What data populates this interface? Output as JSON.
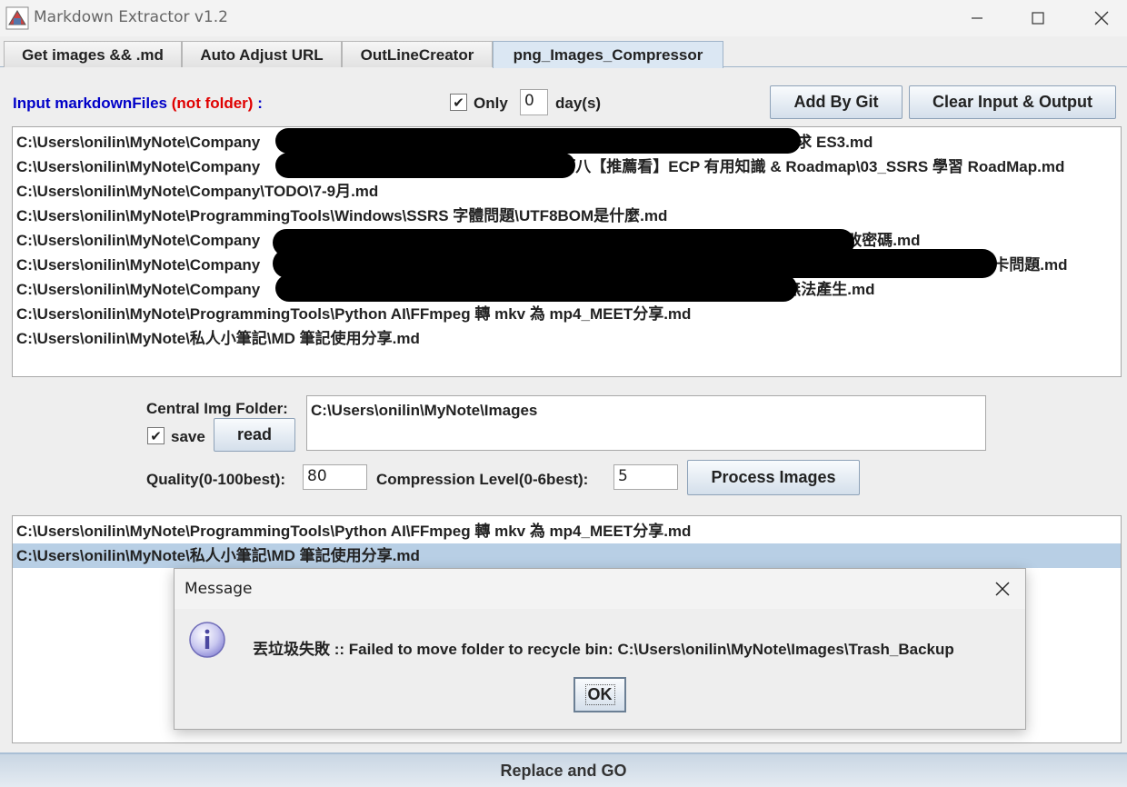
{
  "window": {
    "title": "Markdown Extractor v1.2"
  },
  "tabs": [
    {
      "label": "Get images && .md"
    },
    {
      "label": "Auto Adjust URL"
    },
    {
      "label": "OutLineCreator"
    },
    {
      "label": "png_Images_Compressor",
      "active": true
    }
  ],
  "input_section": {
    "label": "Input markdownFiles",
    "label_note": "(not folder)",
    "label_colon": ":",
    "only_checked": true,
    "only_label": "Only",
    "days_value": "0",
    "days_label": "day(s)",
    "add_by_git": "Add By Git",
    "clear_io": "Clear Input & Output",
    "files": [
      "C:\\Users\\onilin\\MyNote\\Company",
      "C:\\Users\\onilin\\MyNote\\Company",
      "C:\\Users\\onilin\\MyNote\\Company\\TODO\\7-9月.md",
      "C:\\Users\\onilin\\MyNote\\ProgrammingTools\\Windows\\SSRS 字體問題\\UTF8BOM是什麼.md",
      "C:\\Users\\onilin\\MyNote\\Company",
      "C:\\Users\\onilin\\MyNote\\Company",
      "C:\\Users\\onilin\\MyNote\\Company",
      "C:\\Users\\onilin\\MyNote\\ProgrammingTools\\Python AI\\FFmpeg 轉 mkv 為 mp4_MEET分享.md",
      "C:\\Users\\onilin\\MyNote\\私人小筆記\\MD 筆記使用分享.md"
    ],
    "file_suffixes": [
      "求 ES3.md",
      "巧八【推薦看】ECP 有用知識 & Roadmap\\03_SSRS 學習 RoadMap.md",
      "",
      "",
      "麼改密碼.md",
      "打卡問題.md",
      "無法產生.md",
      "",
      ""
    ]
  },
  "settings": {
    "central_img_label": "Central Img Folder:",
    "save_checked": true,
    "save_label": "save",
    "read_label": "read",
    "folder_path": "C:\\Users\\onilin\\MyNote\\Images",
    "quality_label": "Quality(0-100best):",
    "quality_value": "80",
    "compression_label": "Compression Level(0-6best):",
    "compression_value": "5",
    "process_label": "Process Images"
  },
  "output": {
    "rows": [
      "C:\\Users\\onilin\\MyNote\\ProgrammingTools\\Python AI\\FFmpeg 轉 mkv 為 mp4_MEET分享.md",
      "C:\\Users\\onilin\\MyNote\\私人小筆記\\MD 筆記使用分享.md"
    ],
    "selected_index": 1
  },
  "bottom": {
    "replace_go": "Replace and GO"
  },
  "dialog": {
    "title": "Message",
    "message": "丟垃圾失敗 :: Failed to move folder to recycle bin: C:\\Users\\onilin\\MyNote\\Images\\Trash_Backup",
    "ok_label": "OK",
    "icon": "info-icon"
  }
}
